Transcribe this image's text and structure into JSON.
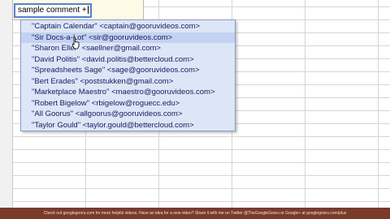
{
  "editor": {
    "value": "sample comment +"
  },
  "autocomplete": {
    "items": [
      "\"Captain Calendar\" <captain@gooruvideos.com>",
      "\"Sir Docs-a-Lot\" <sir@gooruvideos.com>",
      "\"Sharon Eller\" <saellner@gmail.com>",
      "\"David Politis\" <david.politis@bettercloud.com>",
      "\"Spreadsheets Sage\" <sage@gooruvideos.com>",
      "\"Bert Erades\" <poststukken@gmail.com>",
      "\"Marketplace Maestro\" <maestro@gooruvideos.com>",
      "\"Robert Bigelow\" <rbigelow@roguecc.edu>",
      "\"All Goorus\" <allgoorus@gooruvideos.com>",
      "\"Taylor Gould\" <taylor.gould@bettercloud.com>"
    ],
    "highlighted_index": 1
  },
  "footer": {
    "text": "Check out googlegooru.com for more helpful videos. Have an idea for a new video? Share it with me on Twitter @TheGoogleGooru or Google+ at googlegooru.com/plus"
  },
  "colors": {
    "dropdown_bg": "#dde6f7",
    "highlight": "#c3d2f0",
    "footer_bg": "#7a3b2a"
  }
}
